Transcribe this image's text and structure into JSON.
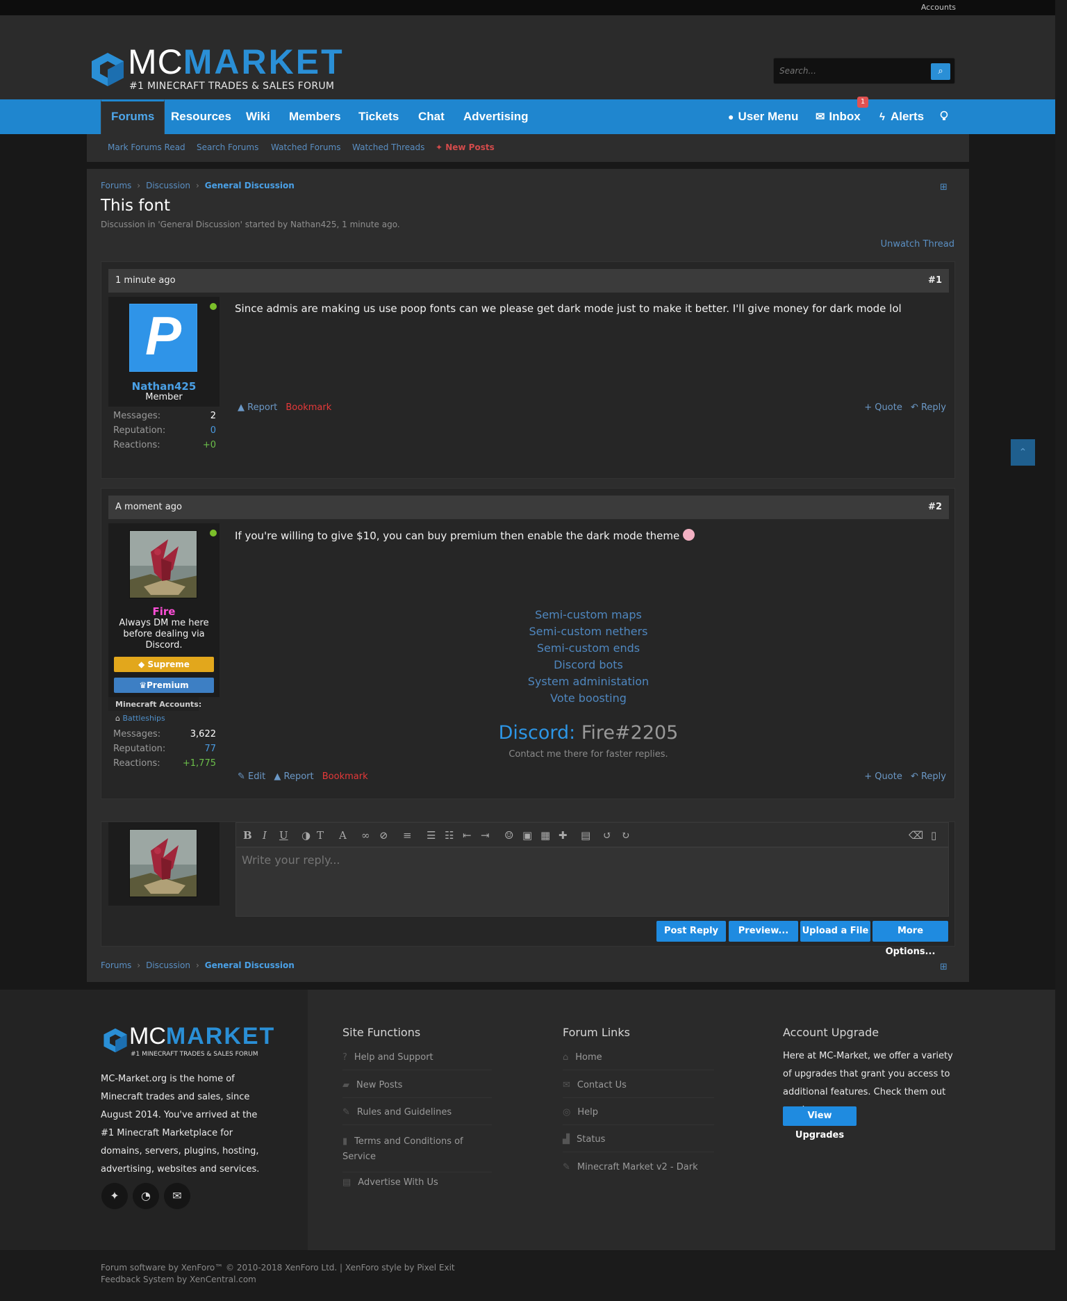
{
  "topbar": {
    "accounts": "Accounts"
  },
  "brand": {
    "word1": "MC",
    "word2": "MARKET",
    "tagline": "#1 MINECRAFT TRADES & SALES FORUM",
    "tagline_small": "#1 MINECRAFT TRADES & SALES FORUM"
  },
  "search": {
    "placeholder": "Search..."
  },
  "nav": {
    "tabs": [
      "Forums",
      "Resources",
      "Wiki",
      "Members",
      "Tickets",
      "Chat",
      "Advertising"
    ],
    "user_menu": "User Menu",
    "inbox": "Inbox",
    "inbox_count": "1",
    "alerts": "Alerts"
  },
  "subnav": [
    "Mark Forums Read",
    "Search Forums",
    "Watched Forums",
    "Watched Threads",
    "New Posts"
  ],
  "breadcrumb": [
    "Forums",
    "Discussion",
    "General Discussion"
  ],
  "thread": {
    "title": "This font",
    "meta": "Discussion in 'General Discussion' started by Nathan425, 1 minute ago.",
    "unwatch": "Unwatch Thread"
  },
  "posts": [
    {
      "time": "1 minute ago",
      "number": "#1",
      "avatar_letter": "P",
      "username": "Nathan425",
      "user_title": "Member",
      "stats": [
        {
          "label": "Messages:",
          "value": "2"
        },
        {
          "label": "Reputation:",
          "value": "0"
        },
        {
          "label": "Reactions:",
          "value": "+0"
        }
      ],
      "message": "Since admis are making us use poop fonts can we please get dark mode just to make it better. I'll give money for dark mode lol",
      "actions": {
        "report": "Report",
        "bookmark": "Bookmark",
        "quote": "+ Quote",
        "reply": "Reply"
      }
    },
    {
      "time": "A moment ago",
      "number": "#2",
      "username": "Fire",
      "user_title_lines": [
        "Always DM me here",
        "before dealing via",
        "Discord."
      ],
      "ranks": [
        "Supreme",
        "Premium"
      ],
      "mc_accounts_label": "Minecraft Accounts:",
      "mc_account": "Battleships",
      "stats": [
        {
          "label": "Messages:",
          "value": "3,622"
        },
        {
          "label": "Reputation:",
          "value": "77"
        },
        {
          "label": "Reactions:",
          "value": "+1,775"
        }
      ],
      "message": "If you're willing to give $10, you can buy premium then enable the dark mode theme",
      "signature_lines": [
        "Semi-custom maps",
        "Semi-custom nethers",
        "Semi-custom ends",
        "Discord bots",
        "System administation",
        "Vote boosting"
      ],
      "discord_key": "Discord:",
      "discord_value": "Fire#2205",
      "contact": "Contact me there for faster replies.",
      "actions": {
        "edit": "Edit",
        "report": "Report",
        "bookmark": "Bookmark",
        "quote": "+ Quote",
        "reply": "Reply"
      }
    }
  ],
  "editor": {
    "placeholder": "Write your reply...",
    "buttons": [
      "Post Reply",
      "Preview...",
      "Upload a File",
      "More Options..."
    ]
  },
  "footer": {
    "description": "MC-Market.org is the home of Minecraft trades and sales, since August 2014. You've arrived at the #1 Minecraft Marketplace for domains, servers, plugins, hosting, advertising, websites and services.",
    "site_functions": {
      "title": "Site Functions",
      "items": [
        "Help and Support",
        "New Posts",
        "Rules and Guidelines",
        "Terms and Conditions of Service",
        "Advertise With Us"
      ]
    },
    "forum_links": {
      "title": "Forum Links",
      "items": [
        "Home",
        "Contact Us",
        "Help",
        "Status",
        "Minecraft Market v2 - Dark"
      ]
    },
    "account_upgrade": {
      "title": "Account Upgrade",
      "text": "Here at MC-Market, we offer a variety of upgrades that grant you access to additional features. Check them out now!",
      "button": "View Upgrades"
    },
    "copyright": "Forum software by XenForo™ © 2010-2018 XenForo Ltd. | XenForo style by Pixel Exit",
    "feedback": "Feedback System by XenCentral.com"
  },
  "colors": {
    "accent": "#1f86cf",
    "bookmark": "#e53939",
    "supreme": "#e2a71c",
    "premium": "#3d7fc4",
    "fire_name": "#ff4fd8"
  }
}
